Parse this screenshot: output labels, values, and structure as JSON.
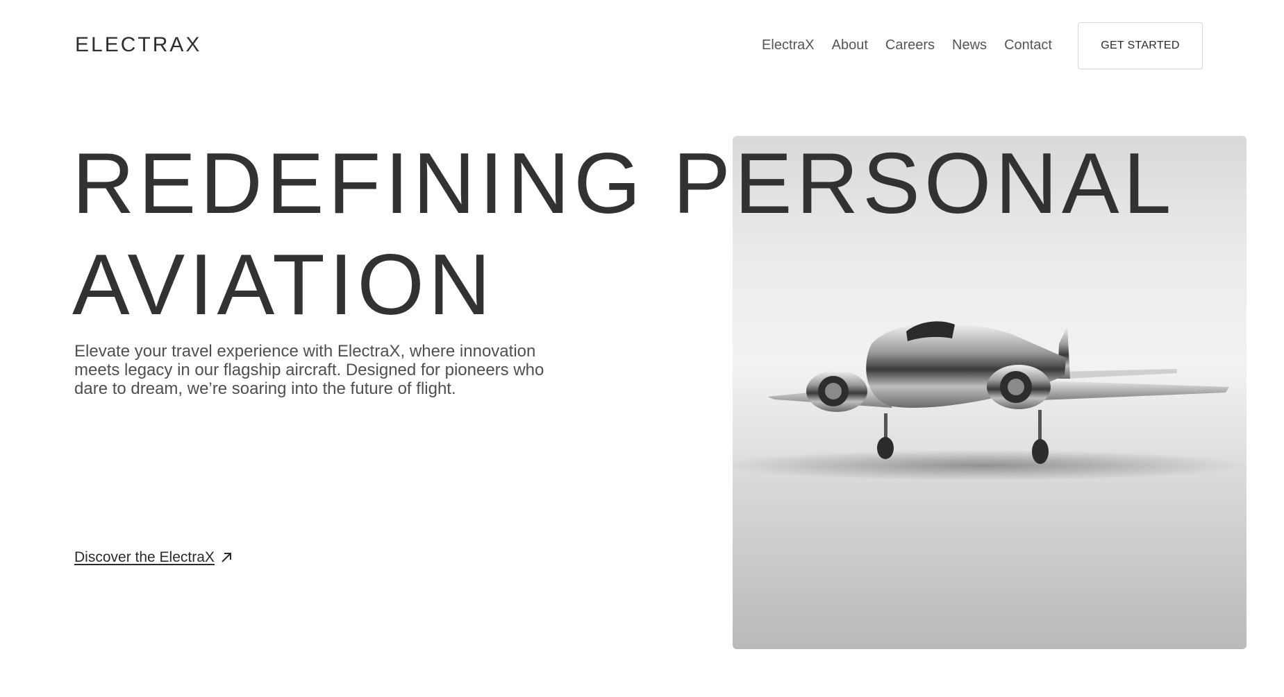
{
  "brand": {
    "logo_text": "ELECTRAX"
  },
  "nav": {
    "items": [
      {
        "label": "ElectraX"
      },
      {
        "label": "About"
      },
      {
        "label": "Careers"
      },
      {
        "label": "News"
      },
      {
        "label": "Contact"
      }
    ],
    "cta_label": "GET STARTED"
  },
  "hero": {
    "headline_line1": "REDEFINING PERSONAL",
    "headline_line2": "AVIATION",
    "description": "Elevate your travel experience with ElectraX, where innovation meets legacy in our flagship aircraft. Designed for pioneers who dare to dream, we’re soaring into the future of flight.",
    "link_label": "Discover the ElectraX",
    "link_icon": "arrow-up-right-icon",
    "image_subject": "chrome-jet-aircraft"
  },
  "colors": {
    "text_dark": "#2f2f2f",
    "text_muted": "#555555",
    "background": "#ffffff"
  }
}
